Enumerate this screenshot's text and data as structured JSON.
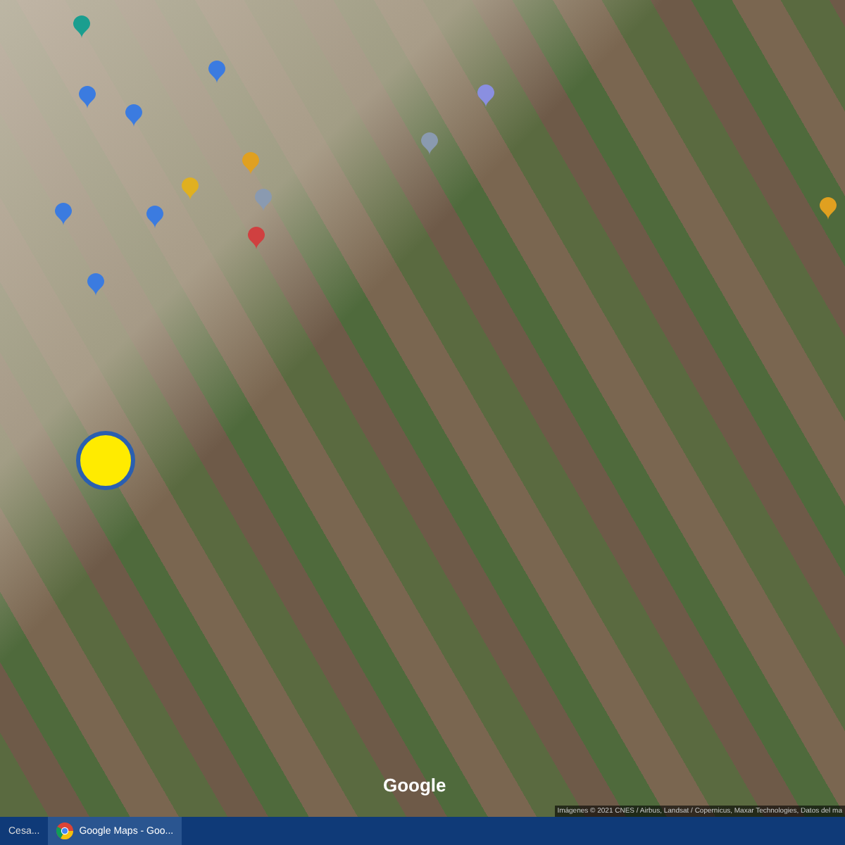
{
  "map": {
    "logo": "Google",
    "attribution": "Imágenes © 2021 CNES / Airbus, Landsat / Copernicus, Maxar Technologies, Datos del ma",
    "pins": [
      {
        "color": "#1a9e8f"
      },
      {
        "color": "#3b7be0"
      },
      {
        "color": "#3b7be0"
      },
      {
        "color": "#3b7be0"
      },
      {
        "color": "#8a8fe0"
      },
      {
        "color": "#e0a020"
      },
      {
        "color": "#e0b020"
      },
      {
        "color": "#3b7be0"
      },
      {
        "color": "#3b7be0"
      },
      {
        "color": "#8a9ab0"
      },
      {
        "color": "#d04040"
      },
      {
        "color": "#3b7be0"
      },
      {
        "color": "#e0a020"
      },
      {
        "color": "#8a9ab0"
      }
    ]
  },
  "taskbar": {
    "items": [
      {
        "label": "Cesa...",
        "selected": false
      },
      {
        "label": "Google Maps - Goo...",
        "selected": true
      }
    ]
  }
}
